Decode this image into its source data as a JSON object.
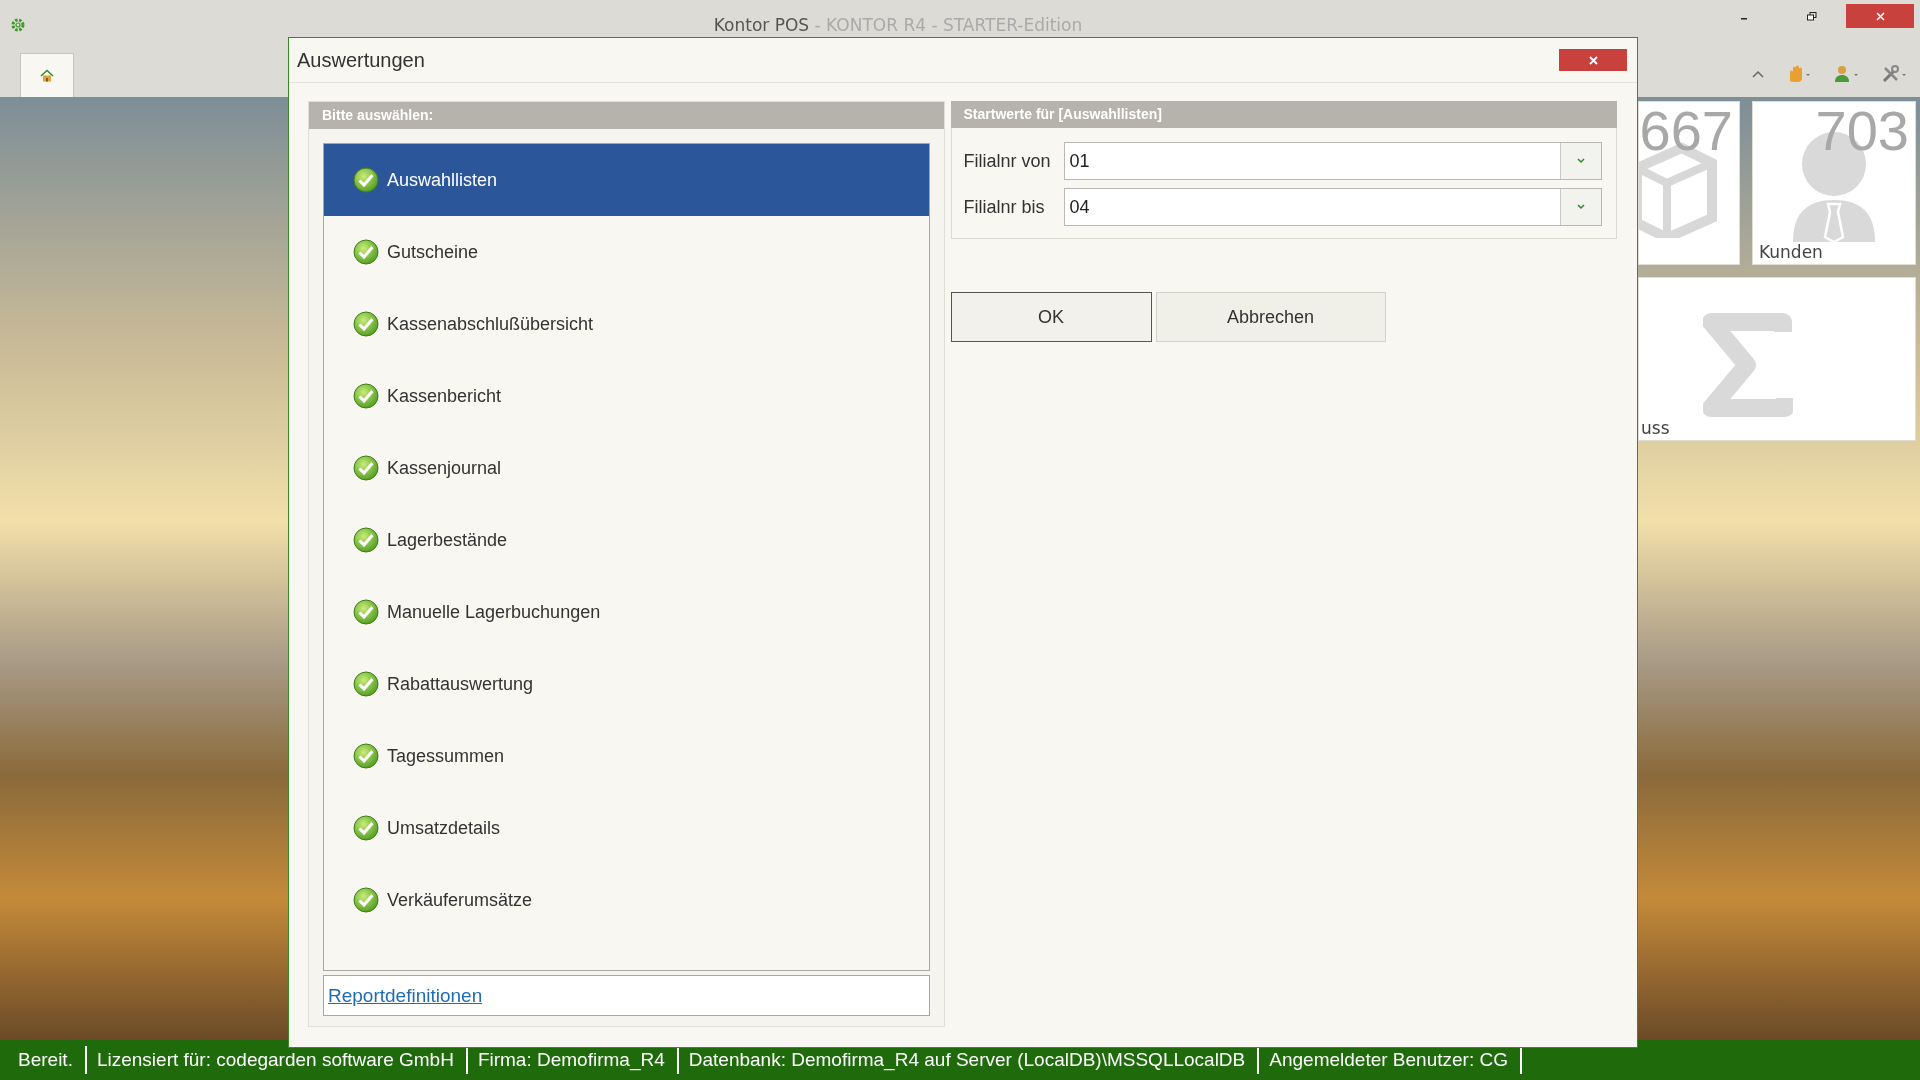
{
  "window": {
    "title": "Kontor POS",
    "subtitle": " - KONTOR R4 - STARTER-Edition"
  },
  "tiles": [
    {
      "kind": "box",
      "number": "667"
    },
    {
      "kind": "person",
      "number": "703",
      "label": "Kunden"
    },
    {
      "kind": "sum",
      "label": "uss"
    }
  ],
  "dialog": {
    "title": "Auswertungen",
    "left_panel": {
      "header": "Bitte auswählen:",
      "items": [
        {
          "label": "Auswahllisten",
          "selected": true
        },
        {
          "label": "Gutscheine",
          "selected": false
        },
        {
          "label": "Kassenabschlußübersicht",
          "selected": false
        },
        {
          "label": "Kassenbericht",
          "selected": false
        },
        {
          "label": "Kassenjournal",
          "selected": false
        },
        {
          "label": "Lagerbestände",
          "selected": false
        },
        {
          "label": "Manuelle Lagerbuchungen",
          "selected": false
        },
        {
          "label": "Rabattauswertung",
          "selected": false
        },
        {
          "label": "Tagessummen",
          "selected": false
        },
        {
          "label": "Umsatzdetails",
          "selected": false
        },
        {
          "label": "Verkäuferumsätze",
          "selected": false
        }
      ],
      "link": "Reportdefinitionen"
    },
    "right_panel": {
      "header": "Startwerte für [Auswahllisten]",
      "fields": [
        {
          "label": "Filialnr von",
          "value": "01"
        },
        {
          "label": "Filialnr bis",
          "value": "04"
        }
      ]
    },
    "buttons": [
      {
        "label": "OK",
        "default": true
      },
      {
        "label": "Abbrechen",
        "default": false
      }
    ]
  },
  "status_bar": [
    "Bereit.",
    "Lizensiert für: codegarden software GmbH",
    "Firma: Demofirma_R4",
    "Datenbank: Demofirma_R4 auf Server (LocalDB)\\MSSQLLocalDB",
    "Angemeldeter Benutzer: CG"
  ]
}
